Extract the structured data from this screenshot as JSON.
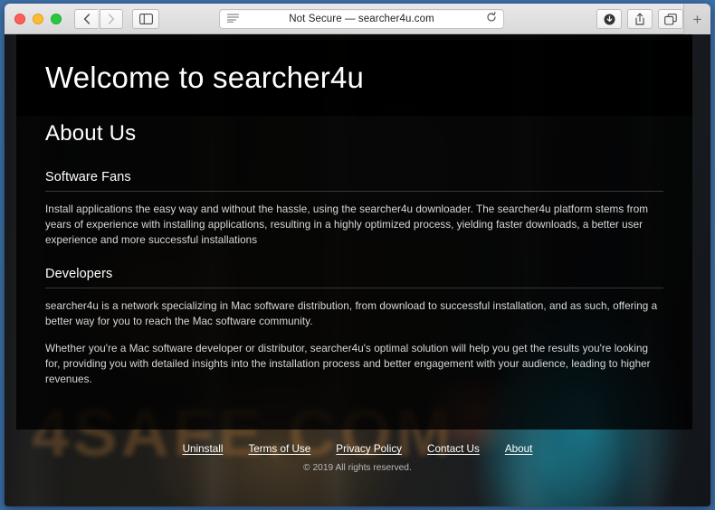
{
  "browser": {
    "window_controls": {
      "close_label": "close",
      "minimize_label": "minimize",
      "zoom_label": "zoom"
    },
    "nav": {
      "back_label": "Back",
      "forward_label": "Forward",
      "sidebar_label": "Show Sidebar"
    },
    "address": {
      "security_text": "Not Secure",
      "separator": "—",
      "domain": "searcher4u.com",
      "full_text": "Not Secure — searcher4u.com",
      "reader_label": "Reader View",
      "reload_label": "Reload"
    },
    "actions": {
      "downloads_label": "Downloads",
      "share_label": "Share",
      "tab_overview_label": "Tab Overview",
      "new_tab_label": "+"
    }
  },
  "page": {
    "hero_title": "Welcome to searcher4u",
    "about_heading": "About Us",
    "watermark_text": "4SAFE.COM",
    "sections": [
      {
        "title": "Software Fans",
        "paragraphs": [
          "Install applications the easy way and without the hassle, using the searcher4u downloader. The searcher4u platform stems from years of experience with installing applications, resulting in a highly optimized process, yielding faster downloads, a better user experience and more successful installations"
        ]
      },
      {
        "title": "Developers",
        "paragraphs": [
          "searcher4u is a network specializing in Mac software distribution, from download to successful installation, and as such, offering a better way for you to reach the Mac software community.",
          "Whether you're a Mac software developer or distributor, searcher4u's optimal solution will help you get the results you're looking for, providing you with detailed insights into the installation process and better engagement with your audience, leading to higher revenues."
        ]
      }
    ],
    "footer": {
      "links": [
        {
          "label": "Uninstall"
        },
        {
          "label": "Terms of Use"
        },
        {
          "label": "Privacy Policy"
        },
        {
          "label": "Contact Us"
        },
        {
          "label": "About"
        }
      ],
      "copyright": "© 2019 All rights reserved."
    }
  },
  "colors": {
    "desktop": "#3d6ea8",
    "toolbar": "#e3e3e3",
    "page_background": "#0a0b0d",
    "text_primary": "#ffffff",
    "text_body": "#d8d8d8",
    "text_muted": "#b9b9b9"
  }
}
